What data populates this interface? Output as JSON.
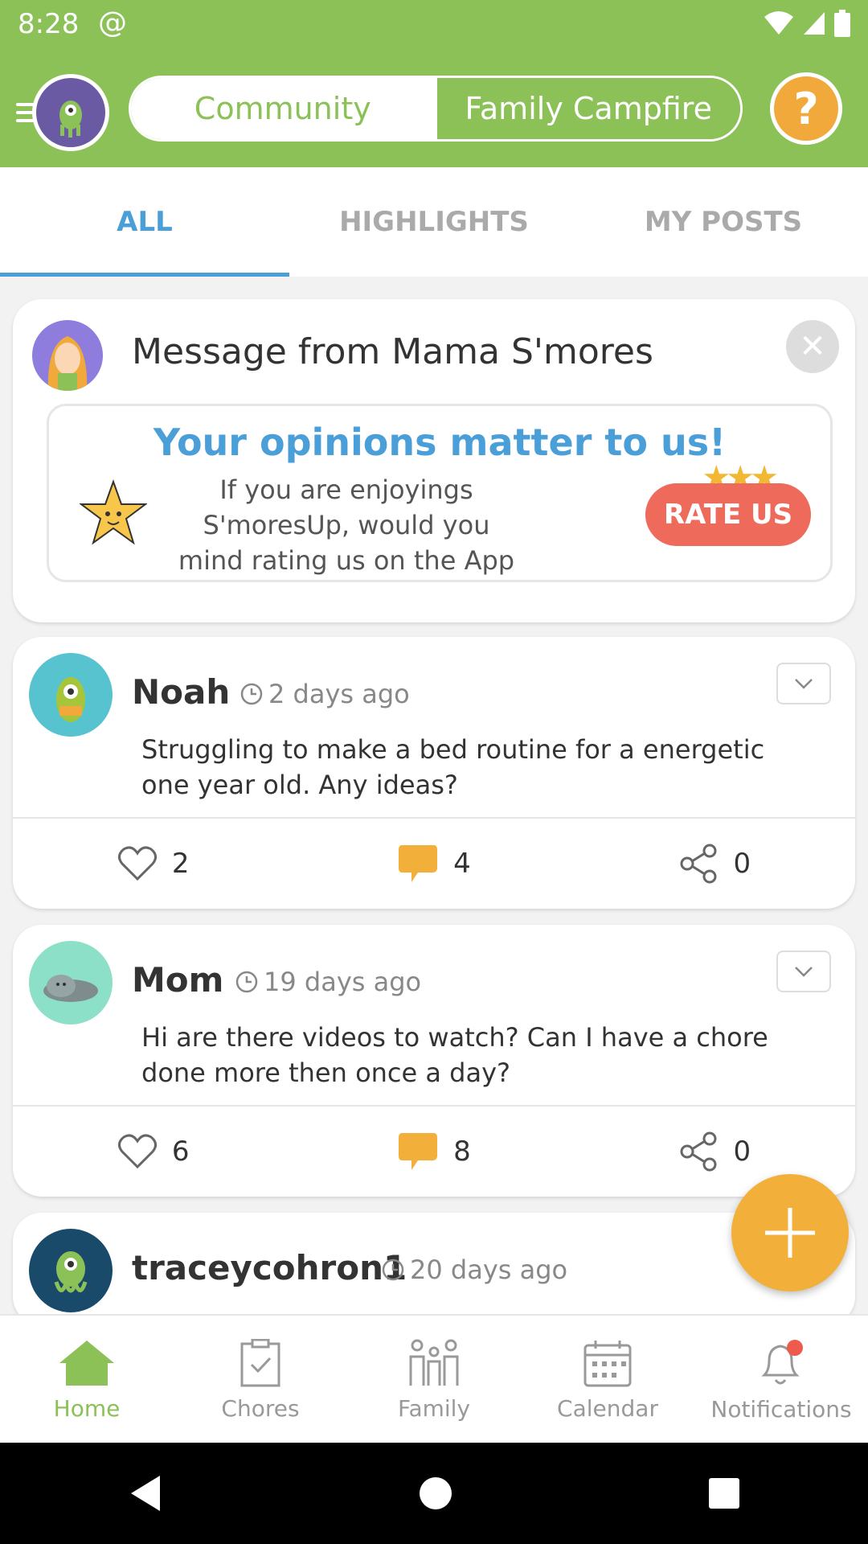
{
  "status_bar": {
    "time": "8:28"
  },
  "header": {
    "tabs": [
      "Community",
      "Family Campfire"
    ],
    "help_label": "?"
  },
  "feed_tabs": [
    "ALL",
    "HIGHLIGHTS",
    "MY POSTS"
  ],
  "message_card": {
    "title": "Message from Mama S'mores",
    "banner_title": "Your opinions matter to us!",
    "banner_text": "If you are enjoyings S'moresUp, would you mind rating us on the App Store?",
    "rate_label": "RATE US"
  },
  "posts": [
    {
      "author": "Noah",
      "time": "2 days ago",
      "text": "Struggling to make a bed routine for a energetic one year old. Any ideas?",
      "likes": "2",
      "comments": "4",
      "shares": "0"
    },
    {
      "author": "Mom",
      "time": "19 days ago",
      "text": "Hi are there videos to watch? Can I have a chore done more then once a day?",
      "likes": "6",
      "comments": "8",
      "shares": "0"
    },
    {
      "author": "traceycohron1",
      "time": "20 days ago"
    }
  ],
  "bottom_nav": [
    "Home",
    "Chores",
    "Family",
    "Calendar",
    "Notifications"
  ],
  "colors": {
    "green": "#8bc157",
    "blue": "#4b9fd8",
    "orange": "#f2b03a",
    "red": "#ee6a5b"
  },
  "icons": [
    "menu-icon",
    "help-icon",
    "close-icon",
    "chevron-down-icon",
    "heart-icon",
    "comment-icon",
    "share-icon",
    "clock-icon",
    "plus-icon",
    "home-icon",
    "chores-icon",
    "family-icon",
    "calendar-icon",
    "bell-icon"
  ]
}
